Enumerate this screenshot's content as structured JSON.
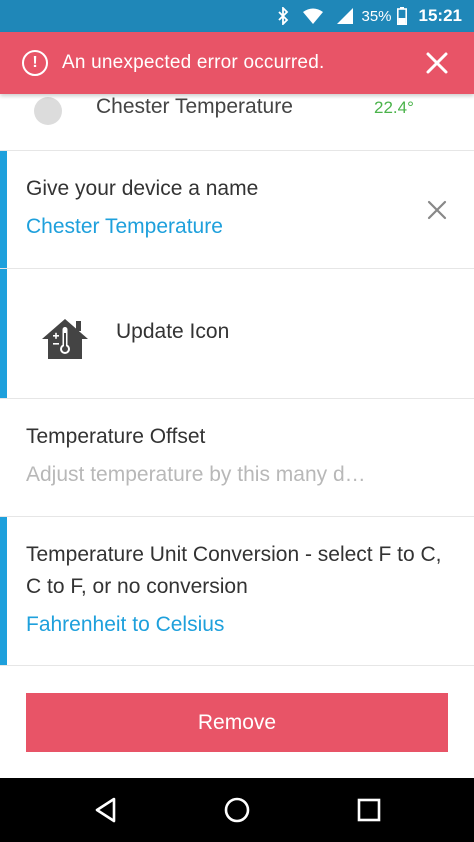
{
  "status_bar": {
    "battery": "35%",
    "time": "15:21",
    "icons": [
      "bluetooth-icon",
      "wifi-icon",
      "cell-signal-icon",
      "battery-icon"
    ]
  },
  "error_banner": {
    "message": "An unexpected error occurred.",
    "icon": "error-circle-icon",
    "close_icon": "close-icon"
  },
  "device_row": {
    "name": "Chester Temperature",
    "temperature": "22.4°"
  },
  "name_field": {
    "label": "Give your device a name",
    "value": "Chester Temperature"
  },
  "icon_field": {
    "label": "Update Icon",
    "icon": "house-thermometer-icon"
  },
  "offset_field": {
    "label": "Temperature Offset",
    "placeholder": "Adjust temperature by this many d…"
  },
  "unit_field": {
    "label": "Temperature Unit Conversion - select F to C, C to F, or no conversion",
    "value": "Fahrenheit to Celsius"
  },
  "remove_button": {
    "label": "Remove"
  },
  "colors": {
    "accent": "#1ea0dc",
    "danger": "#e85467",
    "status_bar": "#1f87b8",
    "temp_green": "#4bb34b"
  }
}
